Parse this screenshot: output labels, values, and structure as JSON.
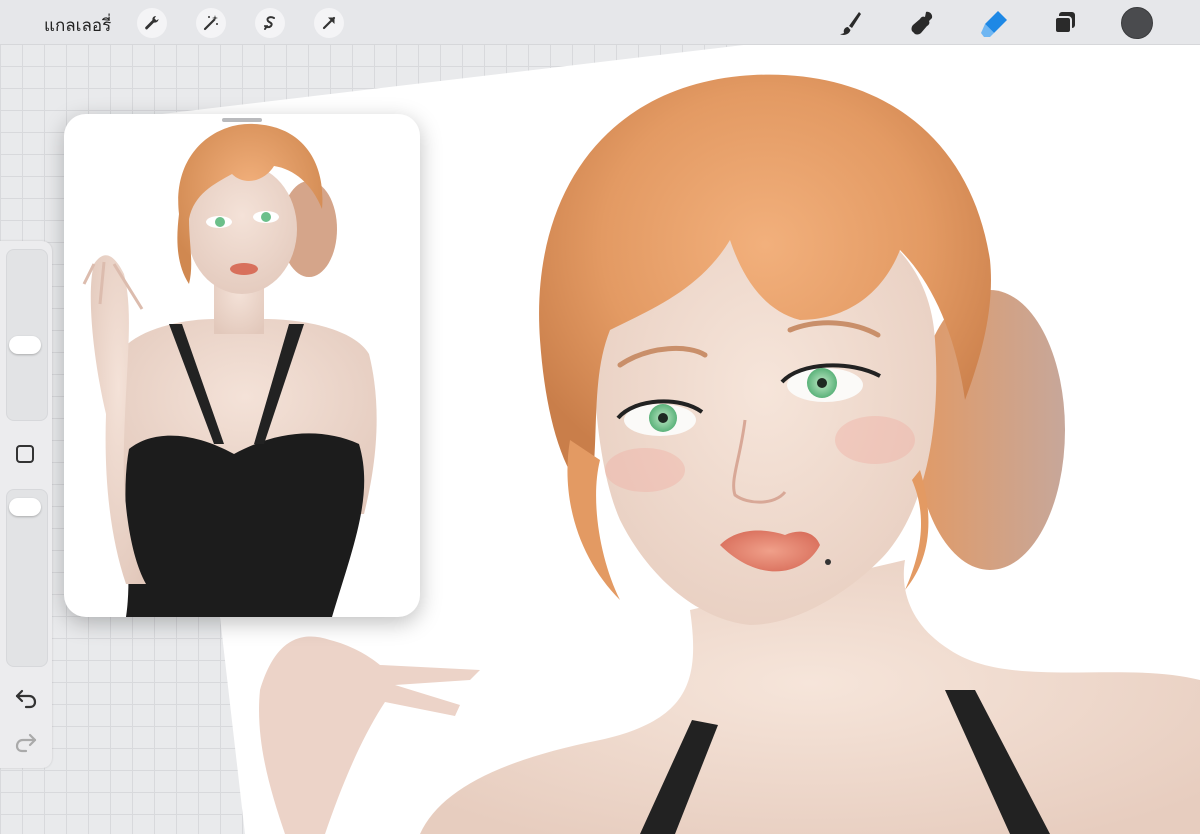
{
  "toolbar": {
    "gallery_label": "แกลเลอรี่",
    "left_tools": [
      "wrench-icon",
      "magic-wand-icon",
      "selection-icon",
      "transform-arrow-icon"
    ],
    "right_tools": [
      "brush-icon",
      "smudge-icon",
      "eraser-icon",
      "layers-icon"
    ],
    "active_tool": "eraser",
    "current_color": "#4a4b4e",
    "accent_color": "#1e88e5"
  },
  "sidebar": {
    "size_slider_value": 0.55,
    "opacity_slider_value": 0.05,
    "icons": [
      "modify-square-icon",
      "undo-icon",
      "redo-icon"
    ]
  },
  "reference_window": {
    "visible": true,
    "content": "reference-illustration"
  }
}
